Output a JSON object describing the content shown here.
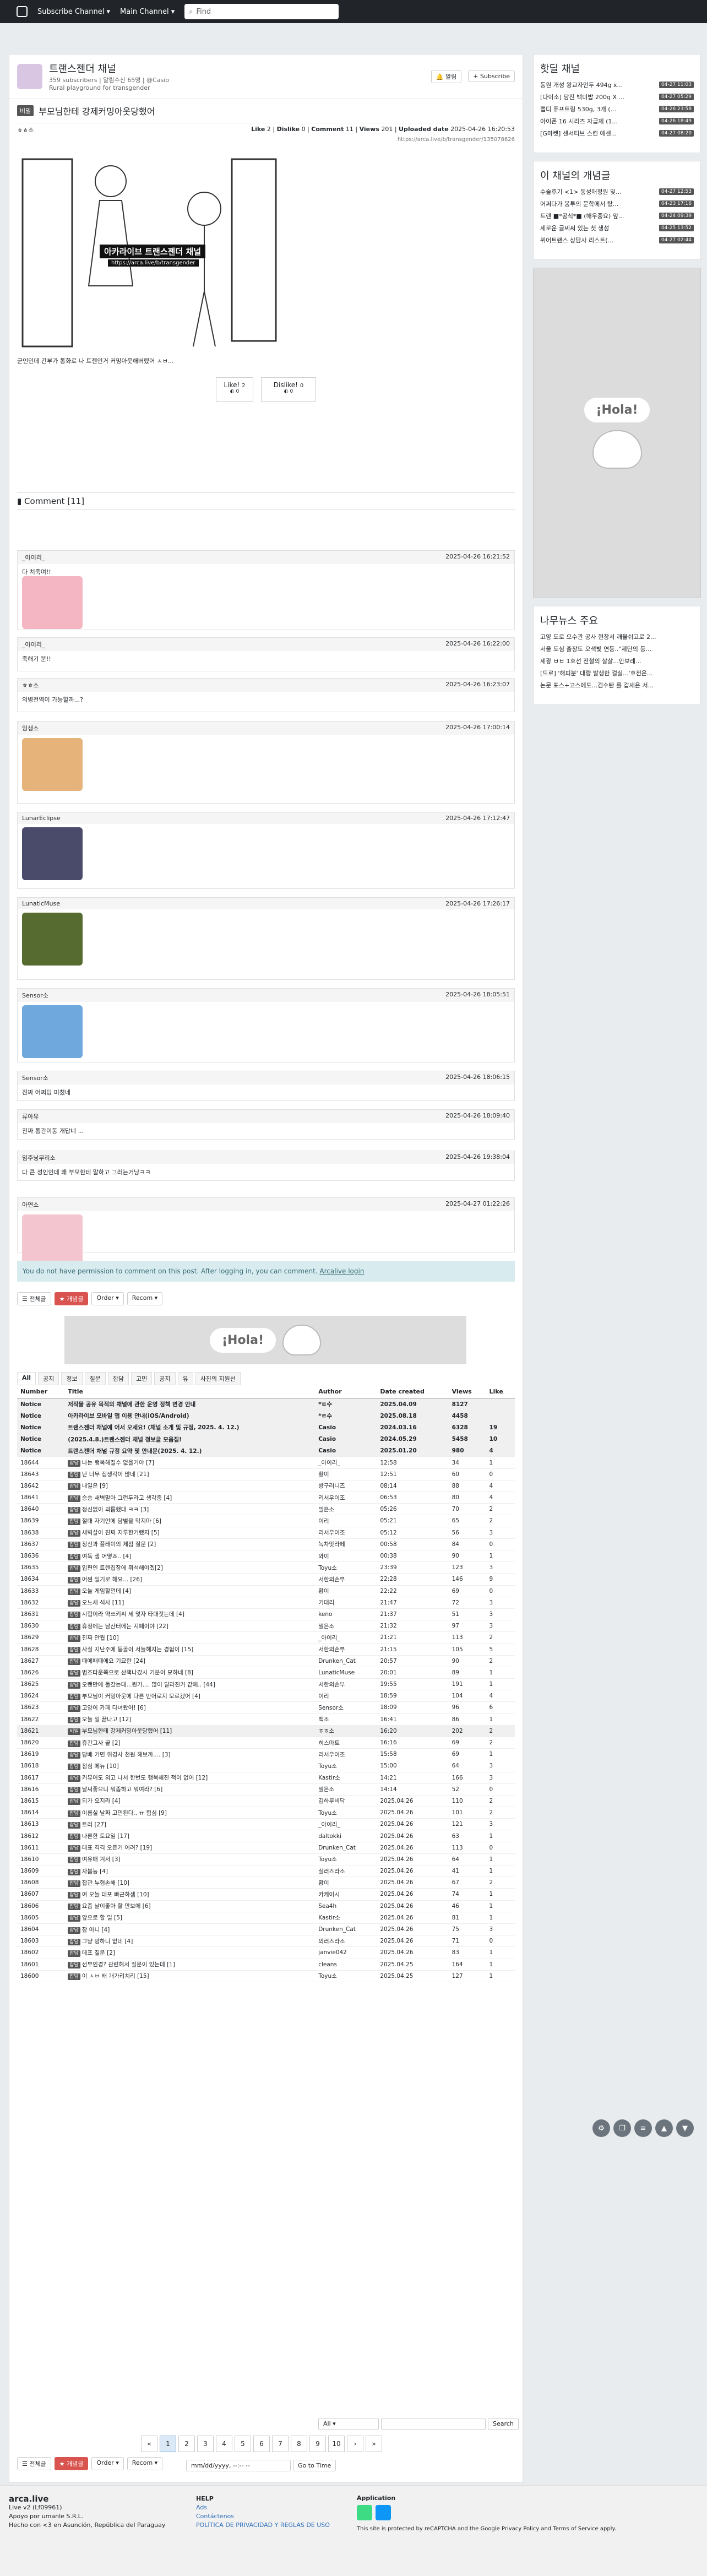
{
  "topnav": {
    "channel_menu": "Subscribe Channel",
    "main_menu": "Main Channel",
    "search_placeholder": "Find"
  },
  "channel": {
    "name": "트랜스젠더 채널",
    "meta": "359 subscribers | 알림수신 65명 | @Casio",
    "desc": "Rural playground for transgender",
    "notify": "알림",
    "subscribe": "Subscribe"
  },
  "post": {
    "tag": "비밀",
    "title": "부모님한테 강제커밍아웃당했어",
    "author": "ㅎㅎ소",
    "like_label": "Like",
    "like": "2",
    "dislike_label": "Dislike",
    "dislike": "0",
    "comment_label": "Comment",
    "comments": "11",
    "views_label": "Views",
    "views": "201",
    "uploaded_label": "Uploaded date",
    "uploaded": "2025-04-26 16:20:53",
    "url": "https://arca.live/b/transgender/135078626",
    "body": "군인인데 간부가 통화로 나 트젠인거 커밍아웃해버렸어 ㅅㅂ...",
    "overlay1": "아카라이브 트랜스젠더 채널",
    "overlay2": "https://arca.live/b/transgender",
    "like_btn": "Like!",
    "like_btn_count": "2",
    "dislike_btn": "Dislike!",
    "dislike_btn_count": "0",
    "like_sub": "0",
    "dislike_sub": "0"
  },
  "comments_header": "Comment [11]",
  "comments": [
    {
      "author": "_아이리_",
      "time": "2025-04-26 16:21:52",
      "text": "다 쳐죽여!!"
    },
    {
      "author": "_아이리_",
      "time": "2025-04-26 16:22:00",
      "text": "죽해기 분!!"
    },
    {
      "author": "ㅎㅎ소",
      "time": "2025-04-26 16:23:07",
      "text": "의병전역이 가능할까...?"
    },
    {
      "author": "잉생소",
      "time": "2025-04-26 17:00:14",
      "text": ""
    },
    {
      "author": "LunarEclipse",
      "time": "2025-04-26 17:12:47",
      "text": ""
    },
    {
      "author": "LunaticMuse",
      "time": "2025-04-26 17:26:17",
      "text": ""
    },
    {
      "author": "Sensor소",
      "time": "2025-04-26 18:05:51",
      "text": ""
    },
    {
      "author": "Sensor소",
      "time": "2025-04-26 18:06:15",
      "text": "진짜 어쩌딩 미쳤네"
    },
    {
      "author": "류아유",
      "time": "2025-04-26 18:09:40",
      "text": "진짜 통관이동 개답네 ..."
    },
    {
      "author": "임주닝무리소",
      "time": "2025-04-26 19:38:04",
      "text": "다 큰 성인인데 왜 부모한테 말하고 그러는거냥ㅋㅋ"
    },
    {
      "author": "아연소",
      "time": "2025-04-27 01:22:26",
      "text": ""
    }
  ],
  "login_notice": "You do not have permission to comment on this post. After logging in, you can comment.",
  "login_link": "Arcalive login",
  "toolbar": {
    "all": "전체글",
    "best": "개념글",
    "order": "Order",
    "recom": "Recom"
  },
  "tabs": [
    "All",
    "공지",
    "정보",
    "질문",
    "잡담",
    "고민",
    "공지",
    "유",
    "사진의 지원선"
  ],
  "table_headers": [
    "Number",
    "Title",
    "Author",
    "Date created",
    "Views",
    "Like"
  ],
  "notices": [
    {
      "num": "Notice",
      "title": "저작물 공유 목적의 채널에 관한 운영 정책 변경 안내",
      "author": "*ㅌ수",
      "date": "2025.04.09",
      "views": "8127",
      "like": ""
    },
    {
      "num": "Notice",
      "title": "아카라이브 모바일 앱 이용 안내(iOS/Android)",
      "author": "*ㅌ수",
      "date": "2025.08.18",
      "views": "4458",
      "like": ""
    },
    {
      "num": "Notice",
      "title": "트랜스젠더 채널에 어서 오세요! (채널 소개 및 규정, 2025. 4. 12.)",
      "author": "Casio",
      "date": "2024.03.16",
      "views": "6328",
      "like": "19"
    },
    {
      "num": "Notice",
      "title": "(2025.4.8.)트랜스젠더 채널 정보글 모음집!",
      "author": "Casio",
      "date": "2024.05.29",
      "views": "5458",
      "like": "10"
    },
    {
      "num": "Notice",
      "title": "트랜스젠더 채널 규정 요약 및 안내문(2025. 4. 12.)",
      "author": "Casio",
      "date": "2025.01.20",
      "views": "980",
      "like": "4"
    }
  ],
  "rows": [
    {
      "num": "18644",
      "badge": "잡담",
      "title": "나는 행복해질수 없을거야 [7]",
      "author": "_아이리_",
      "date": "12:58",
      "views": "34",
      "like": "1"
    },
    {
      "num": "18643",
      "badge": "잡담",
      "title": "난 너무 집생각이 많네 [21]",
      "author": "황이",
      "date": "12:51",
      "views": "60",
      "like": "0"
    },
    {
      "num": "18642",
      "badge": "잡담",
      "title": "내일은 [9]",
      "author": "방구러니즈",
      "date": "08:14",
      "views": "88",
      "like": "4"
    },
    {
      "num": "18641",
      "badge": "잡담",
      "title": "승승 새벽말아 그런두라고 생각중 [4]",
      "author": "리서우이조",
      "date": "06:53",
      "views": "80",
      "like": "4"
    },
    {
      "num": "18640",
      "badge": "잡담",
      "title": "정신없이 괴롭했대 ㅋㅋ [3]",
      "author": "밀은소",
      "date": "05:26",
      "views": "70",
      "like": "2"
    },
    {
      "num": "18639",
      "badge": "잡담",
      "title": "절대 자기언에 담별을 막지마 [6]",
      "author": "이리",
      "date": "05:21",
      "views": "65",
      "like": "2"
    },
    {
      "num": "18638",
      "badge": "잡담",
      "title": "새벽살이 진짜 지루한거랬지 [5]",
      "author": "리서우이조",
      "date": "05:12",
      "views": "56",
      "like": "3"
    },
    {
      "num": "18637",
      "badge": "잡담",
      "title": "정신과 플레이의 제점 질문 [2]",
      "author": "녹차맛라떼",
      "date": "00:58",
      "views": "84",
      "like": "0"
    },
    {
      "num": "18636",
      "badge": "잡담",
      "title": "여독 샘 어떻죠.. [4]",
      "author": "와이",
      "date": "00:38",
      "views": "90",
      "like": "1"
    },
    {
      "num": "18635",
      "badge": "잡담",
      "title": "입편인 트렌칩장에 뭐석해야겠[2]",
      "author": "Toyu소",
      "date": "23:39",
      "views": "123",
      "like": "3"
    },
    {
      "num": "18634",
      "badge": "잡담",
      "title": "어쩐 일기로 해요... [26]",
      "author": "서한의손부",
      "date": "22:28",
      "views": "146",
      "like": "9"
    },
    {
      "num": "18633",
      "badge": "잡담",
      "title": "오늘 게임할껀데 [4]",
      "author": "황이",
      "date": "22:22",
      "views": "69",
      "like": "0"
    },
    {
      "num": "18632",
      "badge": "잡담",
      "title": "오느새 석사 [11]",
      "author": "기대리",
      "date": "21:47",
      "views": "72",
      "like": "3"
    },
    {
      "num": "18631",
      "badge": "잡담",
      "title": "시험이라 약쓰키씨 세 몇자 타대젓는데 [4]",
      "author": "keno",
      "date": "21:37",
      "views": "51",
      "like": "3"
    },
    {
      "num": "18630",
      "badge": "잡담",
      "title": "휴정에는 남산터에는 지폐이야 [22]",
      "author": "밀은소",
      "date": "21:32",
      "views": "97",
      "like": "3"
    },
    {
      "num": "18629",
      "badge": "잡담",
      "title": "진짜 안뭡 [10]",
      "author": "_아이리_",
      "date": "21:21",
      "views": "113",
      "like": "2"
    },
    {
      "num": "18628",
      "badge": "잡담",
      "title": "사실 지난주에 등골이 서늘해지는 경험이 [15]",
      "author": "서한의손부",
      "date": "21:15",
      "views": "105",
      "like": "5"
    },
    {
      "num": "18627",
      "badge": "잡담",
      "title": "때에때때에요 기묘한 [24]",
      "author": "Drunken_Cat",
      "date": "20:57",
      "views": "90",
      "like": "2"
    },
    {
      "num": "18626",
      "badge": "잡담",
      "title": "범조타운쪽으로 산책나갔시 기분이 묘하네 [8]",
      "author": "LunaticMuse",
      "date": "20:01",
      "views": "89",
      "like": "1"
    },
    {
      "num": "18625",
      "badge": "잡담",
      "title": "오랜만에 돌갔는데...뭔가.... 많이 달라진거 같애.. [44]",
      "author": "서한의손부",
      "date": "19:55",
      "views": "191",
      "like": "1"
    },
    {
      "num": "18624",
      "badge": "잡담",
      "title": "부모님이 커밍아웃에 다른 반어로지 모르겠어 [4]",
      "author": "이리",
      "date": "18:59",
      "views": "104",
      "like": "4"
    },
    {
      "num": "18623",
      "badge": "잡담",
      "title": "고양이 카페 다녀왔어! [6]",
      "author": "Sensor소",
      "date": "18:09",
      "views": "96",
      "like": "6"
    },
    {
      "num": "18622",
      "badge": "잡담",
      "title": "오늘 일 끝나고 [12]",
      "author": "백조",
      "date": "16:41",
      "views": "86",
      "like": "1"
    },
    {
      "num": "18621",
      "badge": "비밀",
      "title": "부모님한테 강제커밍아웃당했어 [11]",
      "author": "ㅎㅎ소",
      "date": "16:20",
      "views": "202",
      "like": "2"
    },
    {
      "num": "18620",
      "badge": "잡담",
      "title": "휴간고사 끝 [2]",
      "author": "히스마트",
      "date": "16:16",
      "views": "69",
      "like": "2"
    },
    {
      "num": "18619",
      "badge": "잡담",
      "title": "담배 거면 위경사 천원 해보까.... [3]",
      "author": "리서우이조",
      "date": "15:58",
      "views": "69",
      "like": "1"
    },
    {
      "num": "18618",
      "badge": "잡담",
      "title": "점심 메뉴 [10]",
      "author": "Toyu소",
      "date": "15:00",
      "views": "64",
      "like": "3"
    },
    {
      "num": "18617",
      "badge": "잡담",
      "title": "커뮤어도 외고 나서 한번도 행복해진 적이 없어 [12]",
      "author": "Kastir소",
      "date": "14:21",
      "views": "166",
      "like": "3"
    },
    {
      "num": "18616",
      "badge": "잡담",
      "title": "날씨좋으니 뭐좀하고 뭐여라? [6]",
      "author": "밀은소",
      "date": "14:14",
      "views": "52",
      "like": "0"
    },
    {
      "num": "18615",
      "badge": "잡담",
      "title": "되가 오지라 [4]",
      "author": "김하루비닥",
      "date": "2025.04.26",
      "views": "110",
      "like": "2"
    },
    {
      "num": "18614",
      "badge": "잡담",
      "title": "이름실 날짜 고민된다.. ㅠ 힘심 [9]",
      "author": "Toyu소",
      "date": "2025.04.26",
      "views": "101",
      "like": "2"
    },
    {
      "num": "18613",
      "badge": "잡담",
      "title": "트러 [27]",
      "author": "_아이리_",
      "date": "2025.04.26",
      "views": "121",
      "like": "3"
    },
    {
      "num": "18612",
      "badge": "잡담",
      "title": "나른한 토요일 [17]",
      "author": "daltokki",
      "date": "2025.04.26",
      "views": "63",
      "like": "1"
    },
    {
      "num": "18611",
      "badge": "잡담",
      "title": "대표 격격 오픈거 어려? [19]",
      "author": "Drunken_Cat",
      "date": "2025.04.26",
      "views": "113",
      "like": "0"
    },
    {
      "num": "18610",
      "badge": "잡담",
      "title": "여유매 겨서 [3]",
      "author": "Toyu소",
      "date": "2025.04.26",
      "views": "64",
      "like": "1"
    },
    {
      "num": "18609",
      "badge": "잡담",
      "title": "자봄능 [4]",
      "author": "실러즈라소",
      "date": "2025.04.26",
      "views": "41",
      "like": "1"
    },
    {
      "num": "18608",
      "badge": "잡담",
      "title": "잡관 누형손해 [10]",
      "author": "황이",
      "date": "2025.04.26",
      "views": "67",
      "like": "2"
    },
    {
      "num": "18607",
      "badge": "잡담",
      "title": "여 오늘 데포 빠근하셈 [10]",
      "author": "카케이시",
      "date": "2025.04.26",
      "views": "74",
      "like": "1"
    },
    {
      "num": "18606",
      "badge": "잡담",
      "title": "요즘 날이좋아 할 만보에 [6]",
      "author": "Sea4h",
      "date": "2025.04.26",
      "views": "46",
      "like": "1"
    },
    {
      "num": "18605",
      "badge": "잡담",
      "title": "앞으로 할 일 [5]",
      "author": "Kastir소",
      "date": "2025.04.26",
      "views": "81",
      "like": "1"
    },
    {
      "num": "18604",
      "badge": "잡담",
      "title": "잠 아니 [4]",
      "author": "Drunken_Cat",
      "date": "2025.04.26",
      "views": "75",
      "like": "3"
    },
    {
      "num": "18603",
      "badge": "잡담",
      "title": "그냥 망하니 없네 [4]",
      "author": "의러즈라소",
      "date": "2025.04.26",
      "views": "71",
      "like": "0"
    },
    {
      "num": "18602",
      "badge": "잡담",
      "title": "데포 질문 [2]",
      "author": "janvie042",
      "date": "2025.04.26",
      "views": "83",
      "like": "1"
    },
    {
      "num": "18601",
      "badge": "잡담",
      "title": "선부인경? 관련해서 질문이 있는데 [1]",
      "author": "cleans",
      "date": "2025.04.25",
      "views": "164",
      "like": "1"
    },
    {
      "num": "18600",
      "badge": "잡담",
      "title": "이 ㅅㅂ 배 개가리치리 [15]",
      "author": "Toyu소",
      "date": "2025.04.25",
      "views": "127",
      "like": "1"
    }
  ],
  "search": {
    "scope": "All",
    "button": "Search"
  },
  "pages": [
    "1",
    "2",
    "3",
    "4",
    "5",
    "6",
    "7",
    "8",
    "9",
    "10"
  ],
  "date_placeholder": "mm/dd/yyyy, --:-- --",
  "goto": "Go to Time",
  "sidebar": {
    "hot_title": "핫딜 채널",
    "hot": [
      {
        "t": "동원 개성 왕교자만두 494g x...",
        "time": "04-27 11:03"
      },
      {
        "t": "[다이소] 당진 백미밥 200g X ...",
        "time": "04-27 05:29"
      },
      {
        "t": "랩디 퓨프트링 530g, 3개 (...",
        "time": "04-26 23:58"
      },
      {
        "t": "아이폰 16 시리즈 자급제 (1...",
        "time": "04-26 18:49"
      },
      {
        "t": "[G마켓] 센서티브 스킨 에센...",
        "time": "04-27 08:20"
      }
    ],
    "concept_title": "이 채널의 개념글",
    "concept": [
      {
        "t": "수술후기 <1> 동성애정원 및...",
        "time": "04-27 12:53"
      },
      {
        "t": "어쩌다가 봉투의 문학에서 탔...",
        "time": "04-23 17:16"
      },
      {
        "t": "트랜 ■*공식*■ (해우중요) 앞...",
        "time": "04-24 09:39"
      },
      {
        "t": "세로운 글씨써 있는 첫 생성",
        "time": "04-25 13:52"
      },
      {
        "t": "퀴어트랜스 상담사 리스트(...",
        "time": "04-27 02:44"
      }
    ],
    "news_title": "나무뉴스 주요",
    "news": [
      "고양 도로 오수관 공사 현장서 깨물쉬고로 2...",
      "서울 도심 출장도 오색빛 연등..\"제단의 등...",
      "세광 ㅂㅂ 1호선 전철의 살살...안보레...",
      "[드로] '해피분' 대량 발생한 걸실...'호전은...",
      "논문 표스+고스에도...검수탄 를 갑새은 서..."
    ]
  },
  "hola": "¡Hola!",
  "footer": {
    "brand": "arca.live",
    "version": "Live v2 (Lf09961)",
    "company": "Hecho con <3 en Asunción, República del Paraguay",
    "company2": "Apoyo por umanle S.R.L.",
    "help": "HELP",
    "help1": "Ads",
    "help2": "Contáctenos",
    "help3": "POLÍTICA DE PRIVACIDAD Y REGLAS DE USO",
    "app": "Application",
    "recaptcha": "This site is protected by reCAPTCHA and the Google Privacy Policy and Terms of Service apply."
  }
}
